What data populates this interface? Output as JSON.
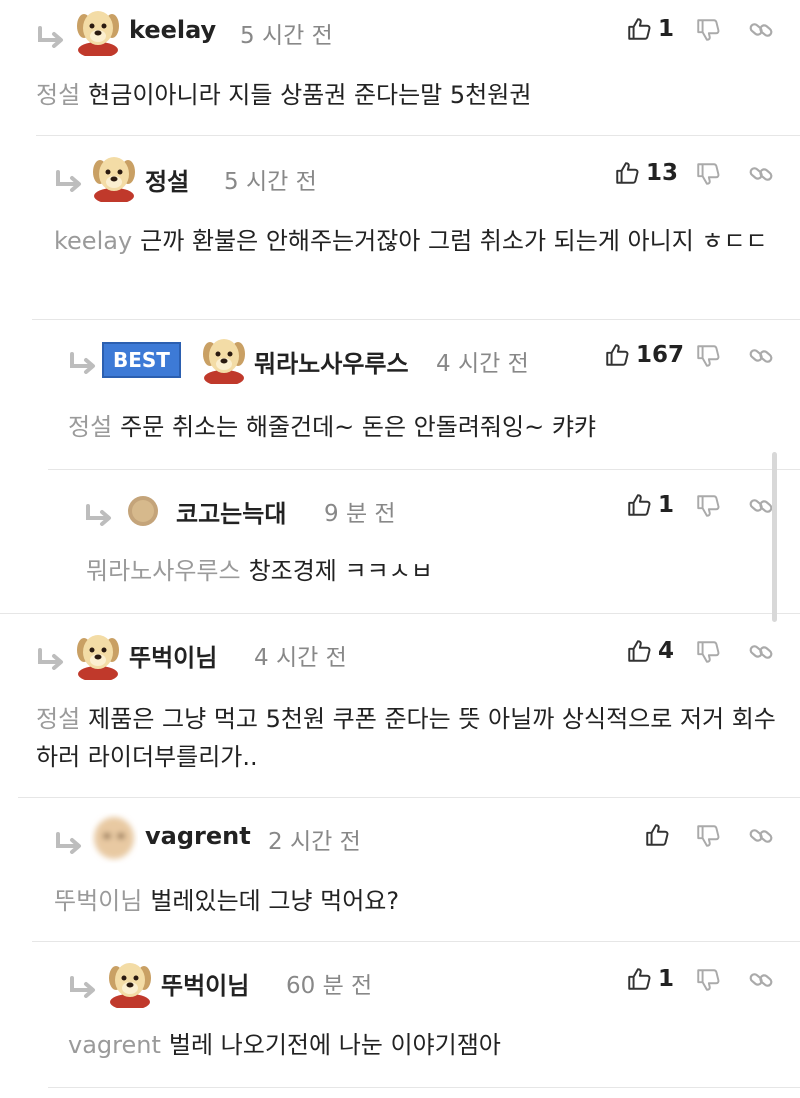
{
  "comments": [
    {
      "name": "keelay",
      "time": "5 시간 전",
      "likes": "1",
      "mention": "정설",
      "text": "현금이아니라 지들 상품권 준다는말 5천원권",
      "best": false
    },
    {
      "name": "정설",
      "time": "5 시간 전",
      "likes": "13",
      "mention": "keelay",
      "text": "근까 환불은 안해주는거잖아 그럼 취소가 되는게 아니지 ㅎㄷㄷ",
      "best": false
    },
    {
      "name": "뭐라노사우루스",
      "time": "4 시간 전",
      "likes": "167",
      "mention": "정설",
      "text": "주문 취소는 해줄건데~ 돈은 안돌려줘잉~ 캬캬",
      "best": true,
      "best_label": "BEST"
    },
    {
      "name": "코고는늑대",
      "time": "9 분 전",
      "likes": "1",
      "mention": "뭐라노사우루스",
      "text": "창조경제 ㅋㅋㅅㅂ",
      "best": false
    },
    {
      "name": "뚜벅이님",
      "time": "4 시간 전",
      "likes": "4",
      "mention": "정설",
      "text": "제품은 그냥 먹고 5천원 쿠폰 준다는 뜻 아닐까 상식적으로 저거 회수하러 라이더부를리가..",
      "best": false
    },
    {
      "name": "vagrent",
      "time": "2 시간 전",
      "likes": "",
      "mention": "뚜벅이님",
      "text": "벌레있는데 그냥 먹어요?",
      "best": false
    },
    {
      "name": "뚜벅이님",
      "time": "60 분 전",
      "likes": "1",
      "mention": "vagrent",
      "text": "벌레 나오기전에 나눈 이야기잼아",
      "best": false
    }
  ],
  "icons": {
    "reply": "reply-arrow-icon",
    "like": "thumbs-up-icon",
    "dislike": "thumbs-down-icon",
    "link": "link-icon"
  },
  "colors": {
    "best_bg": "#3d7ad6",
    "mention": "#9a9a9a",
    "time": "#888888",
    "divider": "#e6e6e6"
  }
}
